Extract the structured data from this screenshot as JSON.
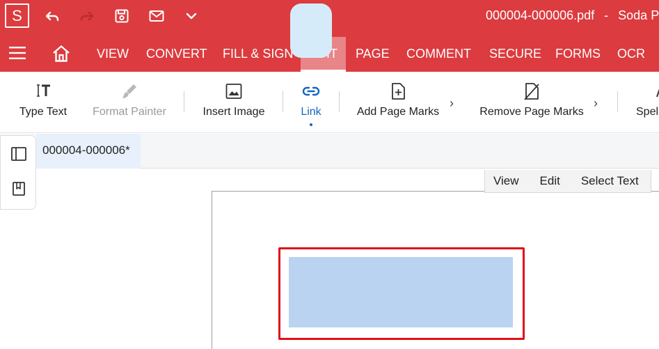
{
  "app": {
    "logo_letter": "S",
    "document_filename": "000004-000006.pdf",
    "title_separator": "-",
    "app_name": "Soda PD"
  },
  "main_tabs": [
    {
      "label": "VIEW",
      "active": false
    },
    {
      "label": "CONVERT",
      "active": false
    },
    {
      "label": "FILL & SIGN",
      "active": false
    },
    {
      "label": "EDIT",
      "active": true
    },
    {
      "label": "PAGE",
      "active": false
    },
    {
      "label": "COMMENT",
      "active": false
    },
    {
      "label": "SECURE",
      "active": false
    },
    {
      "label": "FORMS",
      "active": false
    },
    {
      "label": "OCR",
      "active": false
    }
  ],
  "ribbon": {
    "type_text": "Type Text",
    "format_painter": "Format Painter",
    "insert_image": "Insert Image",
    "link": "Link",
    "add_page_marks": "Add Page Marks",
    "remove_page_marks": "Remove Page Marks",
    "spell": "Spell"
  },
  "document_tab": {
    "label": "000004-000006*"
  },
  "mode_bar": {
    "view": "View",
    "edit": "Edit",
    "select_text": "Select Text"
  },
  "colors": {
    "title_bar": "#dc3b3f",
    "active_tab": "#e98487",
    "link_highlight": "#d6ebfa",
    "link_area_fill": "#b9d3f1",
    "selection_border": "#e01018"
  },
  "icons": {
    "logo": "soda-logo-icon",
    "undo": "undo-icon",
    "redo": "redo-icon",
    "save": "save-icon",
    "email": "email-icon",
    "more": "chevron-down-icon",
    "menu": "hamburger-icon",
    "home": "home-icon"
  }
}
